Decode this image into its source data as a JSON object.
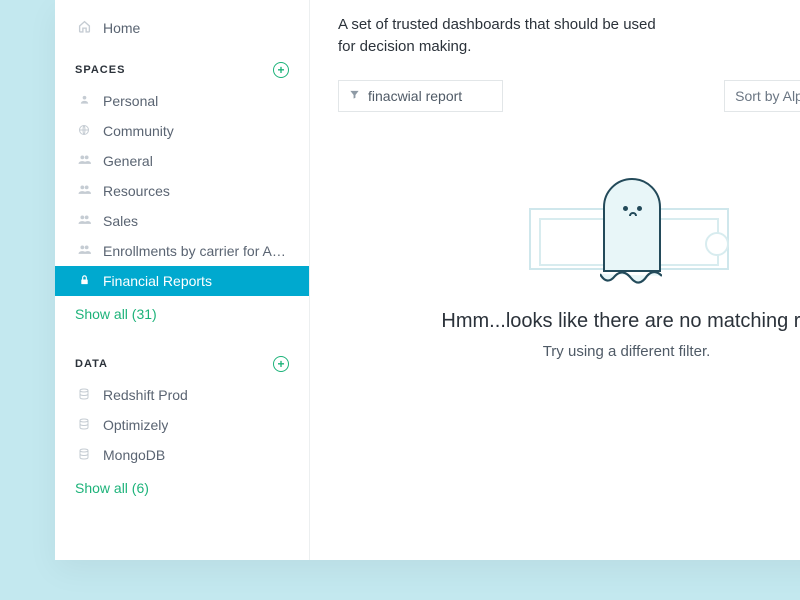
{
  "sidebar": {
    "home": "Home",
    "spaces": {
      "title": "SPACES",
      "items": [
        {
          "icon": "person",
          "label": "Personal"
        },
        {
          "icon": "globe",
          "label": "Community"
        },
        {
          "icon": "people",
          "label": "General"
        },
        {
          "icon": "people",
          "label": "Resources"
        },
        {
          "icon": "people",
          "label": "Sales"
        },
        {
          "icon": "people",
          "label": "Enrollments by carrier for AD a.."
        },
        {
          "icon": "lock",
          "label": "Financial Reports"
        }
      ],
      "showAll": "Show all (31)"
    },
    "data": {
      "title": "DATA",
      "items": [
        {
          "label": "Redshift Prod"
        },
        {
          "label": "Optimizely"
        },
        {
          "label": "MongoDB"
        }
      ],
      "showAll": "Show all (6)"
    }
  },
  "main": {
    "description": "A set of trusted dashboards that should be used for decision making.",
    "filterValue": "finacwial report",
    "sortLabel": "Sort by Alphabe",
    "empty": {
      "title": "Hmm...looks like there are no matching re",
      "subtitle": "Try using a different filter."
    }
  }
}
